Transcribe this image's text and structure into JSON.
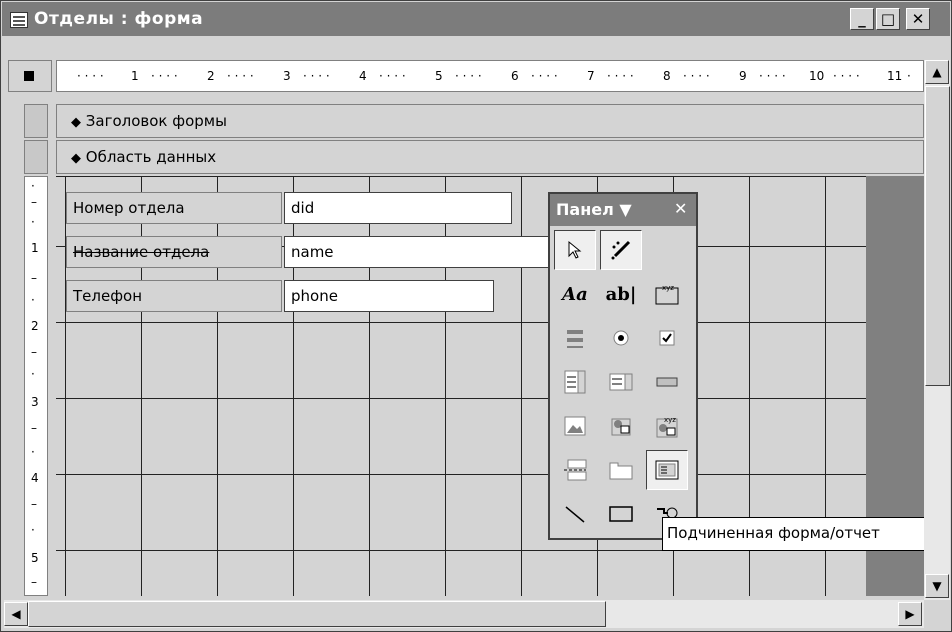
{
  "window": {
    "title": "Отделы : форма",
    "buttons": {
      "minimize": "_",
      "maximize": "□",
      "close": "✕"
    }
  },
  "ruler": {
    "horizontal_numbers": [
      "1",
      "2",
      "3",
      "4",
      "5",
      "6",
      "7",
      "8",
      "9",
      "10",
      "11"
    ],
    "vertical_numbers": [
      "1",
      "2",
      "3",
      "4",
      "5"
    ]
  },
  "sections": {
    "header": "Заголовок формы",
    "detail": "Область данных"
  },
  "fields": [
    {
      "label": "Номер отдела",
      "value": "did"
    },
    {
      "label": "Название отдела",
      "value": "name"
    },
    {
      "label": "Телефон",
      "value": "phone"
    }
  ],
  "toolbox": {
    "title": "Панел ▼",
    "close": "✕",
    "tools": [
      "select-objects-icon",
      "control-wizards-icon",
      "label-icon",
      "textbox-icon",
      "option-group-icon",
      "toggle-button-icon",
      "option-button-icon",
      "checkbox-icon",
      "combobox-icon",
      "listbox-icon",
      "command-button-icon",
      "image-icon",
      "unbound-object-frame-icon",
      "bound-object-frame-icon",
      "page-break-icon",
      "tab-control-icon",
      "subform-icon",
      "line-icon",
      "rectangle-icon",
      "more-controls-icon"
    ]
  },
  "tooltip": "Подчиненная форма/отчет",
  "colors": {
    "titlebar": "#7c7c7c",
    "grid_line": "#222222",
    "background": "#d4d4d4"
  }
}
